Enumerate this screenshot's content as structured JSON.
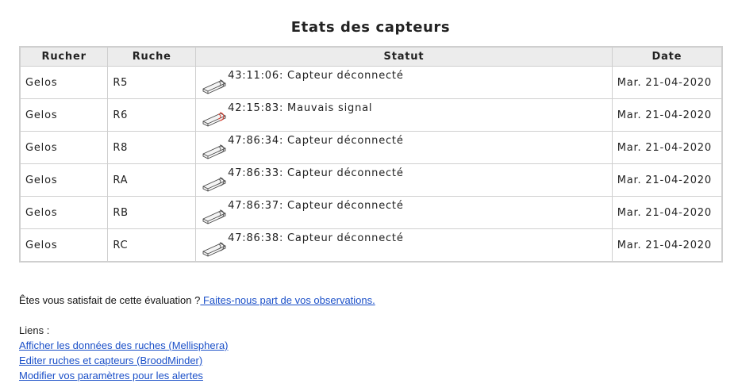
{
  "page": {
    "title": "Etats des capteurs"
  },
  "table": {
    "headers": [
      "Rucher",
      "Ruche",
      "Statut",
      "Date"
    ],
    "rows": [
      {
        "rucher": "Gelos",
        "ruche": "R5",
        "status": "43:11:06: Capteur déconnecté",
        "date": "Mar. 21-04-2020",
        "icon": "sensor-disconnected-icon"
      },
      {
        "rucher": "Gelos",
        "ruche": "R6",
        "status": "42:15:83: Mauvais signal",
        "date": "Mar. 21-04-2020",
        "icon": "sensor-bad-signal-icon"
      },
      {
        "rucher": "Gelos",
        "ruche": "R8",
        "status": "47:86:34: Capteur déconnecté",
        "date": "Mar. 21-04-2020",
        "icon": "sensor-disconnected-icon"
      },
      {
        "rucher": "Gelos",
        "ruche": "RA",
        "status": "47:86:33: Capteur déconnecté",
        "date": "Mar. 21-04-2020",
        "icon": "sensor-disconnected-icon"
      },
      {
        "rucher": "Gelos",
        "ruche": "RB",
        "status": "47:86:37: Capteur déconnecté",
        "date": "Mar. 21-04-2020",
        "icon": "sensor-disconnected-icon"
      },
      {
        "rucher": "Gelos",
        "ruche": "RC",
        "status": "47:86:38: Capteur déconnecté",
        "date": "Mar. 21-04-2020",
        "icon": "sensor-disconnected-icon"
      }
    ]
  },
  "feedback": {
    "question": "Êtes vous satisfait de cette évaluation ?",
    "link": " Faites-nous part de vos observations."
  },
  "links": {
    "label": "Liens :",
    "items": [
      "Afficher les données des ruches (Mellisphera)",
      "Editer ruches et capteurs (BroodMinder)",
      "Modifier vos paramètres pour les alertes"
    ]
  },
  "colors": {
    "link": "#1a4fc8",
    "header_bg": "#ececec",
    "border": "#cfcfcf",
    "signal_red": "#d93a2b"
  }
}
